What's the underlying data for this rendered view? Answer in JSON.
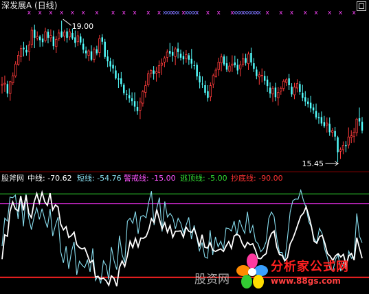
{
  "title": "深发展A (日线)",
  "watermark": "股资网",
  "logo": {
    "name": "分析家公式网",
    "url": "www.88gs.com"
  },
  "chart_data": [
    {
      "type": "candlestick",
      "title": "深发展A (日线)",
      "annotations": [
        {
          "text": "19.00",
          "x": 22,
          "y": 19.0
        },
        {
          "text": "15.45",
          "x": 125,
          "y": 15.45
        }
      ],
      "ohlc": [
        [
          17.38,
          17.59,
          17.17,
          17.4
        ],
        [
          17.41,
          17.62,
          17.21,
          17.43
        ],
        [
          17.41,
          17.49,
          17.08,
          17.17
        ],
        [
          17.17,
          17.49,
          16.99,
          17.47
        ],
        [
          17.44,
          17.7,
          17.38,
          17.61
        ],
        [
          17.61,
          17.98,
          17.57,
          17.91
        ],
        [
          17.9,
          18.24,
          17.87,
          18.13
        ],
        [
          18.1,
          18.38,
          17.96,
          18.3
        ],
        [
          18.32,
          18.47,
          18.1,
          18.28
        ],
        [
          18.26,
          18.38,
          18.12,
          18.2
        ],
        [
          18.22,
          18.49,
          17.99,
          18.39
        ],
        [
          18.4,
          18.84,
          18.31,
          18.76
        ],
        [
          18.77,
          18.9,
          18.31,
          18.57
        ],
        [
          18.56,
          18.73,
          18.5,
          18.6
        ],
        [
          18.6,
          18.64,
          18.34,
          18.51
        ],
        [
          18.55,
          18.66,
          18.35,
          18.46
        ],
        [
          18.5,
          18.82,
          18.45,
          18.72
        ],
        [
          18.72,
          18.79,
          18.43,
          18.57
        ],
        [
          18.57,
          18.78,
          18.47,
          18.63
        ],
        [
          18.6,
          18.75,
          18.27,
          18.36
        ],
        [
          18.35,
          18.61,
          18.19,
          18.53
        ],
        [
          18.55,
          18.78,
          18.49,
          18.69
        ],
        [
          18.73,
          19.0,
          18.57,
          18.59
        ],
        [
          18.61,
          18.77,
          18.48,
          18.71
        ],
        [
          18.73,
          18.81,
          18.45,
          18.57
        ],
        [
          18.59,
          18.8,
          18.51,
          18.72
        ],
        [
          18.69,
          18.8,
          18.52,
          18.55
        ],
        [
          18.58,
          18.75,
          18.33,
          18.44
        ],
        [
          18.47,
          18.74,
          18.36,
          18.62
        ],
        [
          18.6,
          18.68,
          18.39,
          18.45
        ],
        [
          18.42,
          18.55,
          18.18,
          18.27
        ],
        [
          18.25,
          18.35,
          18.05,
          18.18
        ],
        [
          18.13,
          18.28,
          17.98,
          18.24
        ],
        [
          18.23,
          18.38,
          17.98,
          18.02
        ],
        [
          18.03,
          18.33,
          17.95,
          18.28
        ],
        [
          18.28,
          18.37,
          18.13,
          18.18
        ],
        [
          18.2,
          18.64,
          18.08,
          18.55
        ],
        [
          18.58,
          18.66,
          18.4,
          18.47
        ],
        [
          18.47,
          18.54,
          18.04,
          18.09
        ],
        [
          18.1,
          18.26,
          17.83,
          17.98
        ],
        [
          17.98,
          18.07,
          17.72,
          17.85
        ],
        [
          17.89,
          18.03,
          17.67,
          17.8
        ],
        [
          17.75,
          17.87,
          17.52,
          17.55
        ],
        [
          17.55,
          17.68,
          17.31,
          17.52
        ],
        [
          17.55,
          17.71,
          17.34,
          17.41
        ],
        [
          17.39,
          17.43,
          17.13,
          17.18
        ],
        [
          17.16,
          17.26,
          17.01,
          17.15
        ],
        [
          17.13,
          17.3,
          16.94,
          17.05
        ],
        [
          17.05,
          17.2,
          16.87,
          16.98
        ],
        [
          16.98,
          17.2,
          16.72,
          16.84
        ],
        [
          16.83,
          16.98,
          16.64,
          16.73
        ],
        [
          16.75,
          17.07,
          16.53,
          16.96
        ],
        [
          16.93,
          17.26,
          16.84,
          17.22
        ],
        [
          17.2,
          17.49,
          17.07,
          17.37
        ],
        [
          17.39,
          17.75,
          17.34,
          17.67
        ],
        [
          17.68,
          17.78,
          17.57,
          17.75
        ],
        [
          17.75,
          17.86,
          17.52,
          17.66
        ],
        [
          17.68,
          17.84,
          17.47,
          17.72
        ],
        [
          17.7,
          18.0,
          17.57,
          17.87
        ],
        [
          17.88,
          18.05,
          17.64,
          17.93
        ],
        [
          17.96,
          18.11,
          17.83,
          18.06
        ],
        [
          18.08,
          18.28,
          17.96,
          18.21
        ],
        [
          18.24,
          18.44,
          18.09,
          18.17
        ],
        [
          18.21,
          18.36,
          17.97,
          18.12
        ],
        [
          18.1,
          18.34,
          17.88,
          18.29
        ],
        [
          18.3,
          18.45,
          18.05,
          18.21
        ],
        [
          18.17,
          18.27,
          18.0,
          18.07
        ],
        [
          18.11,
          18.22,
          17.9,
          18.03
        ],
        [
          18.05,
          18.26,
          17.94,
          18.15
        ],
        [
          18.13,
          18.19,
          17.89,
          18.02
        ],
        [
          18.04,
          18.29,
          17.8,
          17.92
        ],
        [
          17.88,
          17.99,
          17.77,
          17.87
        ],
        [
          17.89,
          17.95,
          17.51,
          17.6
        ],
        [
          17.61,
          17.71,
          17.3,
          17.45
        ],
        [
          17.42,
          17.6,
          17.31,
          17.41
        ],
        [
          17.38,
          17.49,
          17.13,
          17.19
        ],
        [
          17.23,
          17.38,
          16.97,
          17.06
        ],
        [
          17.09,
          17.45,
          16.98,
          17.37
        ],
        [
          17.41,
          17.67,
          17.31,
          17.62
        ],
        [
          17.6,
          17.82,
          17.57,
          17.76
        ],
        [
          17.77,
          18.07,
          17.61,
          17.96
        ],
        [
          17.94,
          18.17,
          17.73,
          18.09
        ],
        [
          18.1,
          18.15,
          17.86,
          17.9
        ],
        [
          17.93,
          18.11,
          17.71,
          17.77
        ],
        [
          17.73,
          17.96,
          17.7,
          17.86
        ],
        [
          17.88,
          18.13,
          17.71,
          17.91
        ],
        [
          17.95,
          18.12,
          17.82,
          17.88
        ],
        [
          17.89,
          18.04,
          17.65,
          17.75
        ],
        [
          17.79,
          17.99,
          17.6,
          17.89
        ],
        [
          17.9,
          18.18,
          17.84,
          18.04
        ],
        [
          18.06,
          18.17,
          17.87,
          17.94
        ],
        [
          17.92,
          18.22,
          17.76,
          18.16
        ],
        [
          18.19,
          18.32,
          17.87,
          17.95
        ],
        [
          17.93,
          18.06,
          17.71,
          17.79
        ],
        [
          17.77,
          17.85,
          17.53,
          17.61
        ],
        [
          17.59,
          17.72,
          17.39,
          17.64
        ],
        [
          17.63,
          17.8,
          17.45,
          17.63
        ],
        [
          17.61,
          17.74,
          17.39,
          17.49
        ],
        [
          17.52,
          17.61,
          17.21,
          17.36
        ],
        [
          17.32,
          17.45,
          17.06,
          17.17
        ],
        [
          17.16,
          17.36,
          16.96,
          17.3
        ],
        [
          17.32,
          17.44,
          16.98,
          17.08
        ],
        [
          17.06,
          17.33,
          16.87,
          17.2
        ],
        [
          17.23,
          17.35,
          17.14,
          17.3
        ],
        [
          17.3,
          17.53,
          17.23,
          17.48
        ],
        [
          17.45,
          17.56,
          17.36,
          17.52
        ],
        [
          17.55,
          17.66,
          17.26,
          17.38
        ],
        [
          17.34,
          17.43,
          17.09,
          17.15
        ],
        [
          17.14,
          17.44,
          17.03,
          17.33
        ],
        [
          17.31,
          17.53,
          17.2,
          17.42
        ],
        [
          17.41,
          17.48,
          17.14,
          17.21
        ],
        [
          17.19,
          17.39,
          16.98,
          17.06
        ],
        [
          17.08,
          17.23,
          16.86,
          16.97
        ],
        [
          16.97,
          17.06,
          16.82,
          16.91
        ],
        [
          16.94,
          17.11,
          16.7,
          16.8
        ],
        [
          16.82,
          16.91,
          16.66,
          16.75
        ],
        [
          16.73,
          16.92,
          16.52,
          16.57
        ],
        [
          16.58,
          16.69,
          16.41,
          16.55
        ],
        [
          16.58,
          16.72,
          16.36,
          16.42
        ],
        [
          16.45,
          16.61,
          16.31,
          16.35
        ],
        [
          16.38,
          16.57,
          16.19,
          16.43
        ],
        [
          16.41,
          16.57,
          16.11,
          16.2
        ],
        [
          16.2,
          16.31,
          16.08,
          16.24
        ],
        [
          16.23,
          16.33,
          15.99,
          16.09
        ],
        [
          16.07,
          16.11,
          15.45,
          15.7
        ],
        [
          15.72,
          15.82,
          15.53,
          15.76
        ],
        [
          15.76,
          15.97,
          15.65,
          15.87
        ],
        [
          15.88,
          15.98,
          15.7,
          15.85
        ],
        [
          15.88,
          16.32,
          15.79,
          16.08
        ],
        [
          16.07,
          16.25,
          15.93,
          16.11
        ],
        [
          16.1,
          16.31,
          15.94,
          16.2
        ],
        [
          16.19,
          16.56,
          16.1,
          16.53
        ],
        [
          16.55,
          16.82,
          16.36,
          16.47
        ],
        [
          16.46,
          16.58,
          16.17,
          16.24
        ]
      ],
      "markers_top": {
        "symbol": "x",
        "sets": [
          {
            "name": "",
            "color": "#ff44ff",
            "indices": [
              10,
              14,
              18,
              22,
              26,
              30,
              35,
              41,
              45,
              49,
              54,
              58,
              63,
              67,
              72,
              76,
              80,
              85,
              89,
              94,
              98,
              103,
              107,
              112,
              116,
              121,
              125,
              130
            ]
          },
          {
            "name": "",
            "color": "#7777ff",
            "indices": [
              60,
              61,
              62,
              63,
              64,
              65,
              68,
              69,
              70,
              71,
              72,
              86,
              87,
              88,
              89,
              90,
              91,
              92,
              93,
              94,
              95
            ]
          }
        ]
      }
    },
    {
      "type": "line",
      "title": "股斧网",
      "ylim": [
        -100,
        5
      ],
      "series": [
        {
          "name": "中线",
          "value_label": "-70.62",
          "color": "#ffffff",
          "values": [
            -71.5,
            -46.7,
            -48.1,
            -22.8,
            -13.2,
            -20.5,
            -22.3,
            -7.2,
            -21.8,
            -6.4,
            -24.5,
            -29.2,
            -13.5,
            -4.6,
            -14.2,
            -3.4,
            -12.9,
            -16.7,
            -4.2,
            -21.4,
            -16.2,
            -18.4,
            -35.9,
            -41.6,
            -38.4,
            -49.4,
            -47.5,
            -44.0,
            -56.7,
            -59.7,
            -61.1,
            -60.0,
            -67.2,
            -75.0,
            -72.7,
            -89.7,
            -89.2,
            -91.8,
            -90.8,
            -93.4,
            -98.1,
            -88.5,
            -91.1,
            -99.0,
            -80.0,
            -73.4,
            -79.0,
            -67.9,
            -53.3,
            -59.6,
            -50.3,
            -58.9,
            -50.0,
            -50.2,
            -48.5,
            -41.5,
            -30.2,
            -34.2,
            -21.0,
            -31.0,
            -40.7,
            -34.4,
            -44.2,
            -37.3,
            -49.2,
            -43.0,
            -43.0,
            -42.7,
            -49.1,
            -38.8,
            -43.1,
            -44.2,
            -40.0,
            -48.0,
            -58.6,
            -46.6,
            -59.3,
            -60.2,
            -54.7,
            -62.1,
            -63.7,
            -62.2,
            -61.1,
            -63.6,
            -58.1,
            -53.6,
            -60.4,
            -47.9,
            -45.9,
            -47.8,
            -55.2,
            -59.8,
            -54.3,
            -56.9,
            -55.8,
            -62.2,
            -70.6,
            -71.1,
            -67.9,
            -66.0,
            -52.3,
            -45.3,
            -42.8,
            -59.3,
            -66.7,
            -67.7,
            -73.2,
            -70.0,
            -56.1,
            -50.7,
            -43.4,
            -35.4,
            -27.6,
            -24.6,
            -18.1,
            -27.3,
            -38.4,
            -53.2,
            -55.3,
            -48.6,
            -47.1,
            -55.2,
            -65.8,
            -68.4,
            -72.8,
            -68.0,
            -65.9,
            -69.3,
            -66.6,
            -77.8,
            -68.0,
            -65.7,
            -72.5,
            -49.6,
            -60.3,
            -70.6
          ]
        },
        {
          "name": "短线",
          "value_label": "-54.76",
          "color": "#88ddee",
          "values": [
            -58.1,
            -29.7,
            -32.7,
            -8.2,
            -8.9,
            -6.3,
            -30.7,
            -6.9,
            -38.0,
            -5.3,
            -29.6,
            -41.5,
            -28.6,
            -19.2,
            -31.0,
            -20.0,
            -30.9,
            -39.4,
            -20.3,
            -48.0,
            -37.1,
            -28.6,
            -64.0,
            -75.3,
            -58.2,
            -81.3,
            -64.2,
            -53.8,
            -87.4,
            -73.6,
            -77.5,
            -80.1,
            -72.4,
            -84.5,
            -60.5,
            -93.3,
            -88.4,
            -96.2,
            -73.2,
            -77.9,
            -92.2,
            -59.2,
            -73.1,
            -82.2,
            -47.6,
            -66.8,
            -75.1,
            -32.8,
            -29.8,
            -35.0,
            -22.9,
            -45.7,
            -28.2,
            -27.0,
            -29.4,
            -13.3,
            -2.2,
            -36.8,
            -19.8,
            -8.7,
            -43.4,
            -12.8,
            -28.7,
            -24.8,
            -28.8,
            -40.5,
            -29.8,
            -34.8,
            -44.7,
            -37.0,
            -28.9,
            -51.1,
            -37.1,
            -49.3,
            -62.9,
            -54.5,
            -69.1,
            -70.6,
            -42.1,
            -67.2,
            -48.8,
            -58.9,
            -53.2,
            -61.6,
            -39.7,
            -40.3,
            -42.8,
            -32.7,
            -47.4,
            -31.4,
            -39.2,
            -45.2,
            -23.2,
            -44.9,
            -37.2,
            -52.9,
            -55.8,
            -63.9,
            -60.7,
            -53.8,
            -29.9,
            -23.4,
            -28.2,
            -50.2,
            -64.6,
            -64.8,
            -73.5,
            -50.2,
            -23.7,
            -11.9,
            -10.2,
            -10.4,
            -1.2,
            -11.7,
            -18.8,
            -33.3,
            -39.1,
            -50.3,
            -54.5,
            -40.1,
            -45.4,
            -61.6,
            -70.0,
            -81.3,
            -83.8,
            -71.7,
            -67.1,
            -83.8,
            -74.5,
            -81.9,
            -63.4,
            -70.6,
            -68.9,
            -24.9,
            -48.2,
            -54.8
          ]
        }
      ],
      "reference_lines": [
        {
          "name": "警戒线",
          "value": -15.0,
          "value_label": "-15.00",
          "color": "#ff33ff"
        },
        {
          "name": "逃顶线",
          "value": -5.0,
          "value_label": "-5.00",
          "color": "#33dd33"
        },
        {
          "name": "抄底线",
          "value": -90.0,
          "value_label": "-90.00",
          "color": "#ff2222"
        }
      ]
    }
  ]
}
